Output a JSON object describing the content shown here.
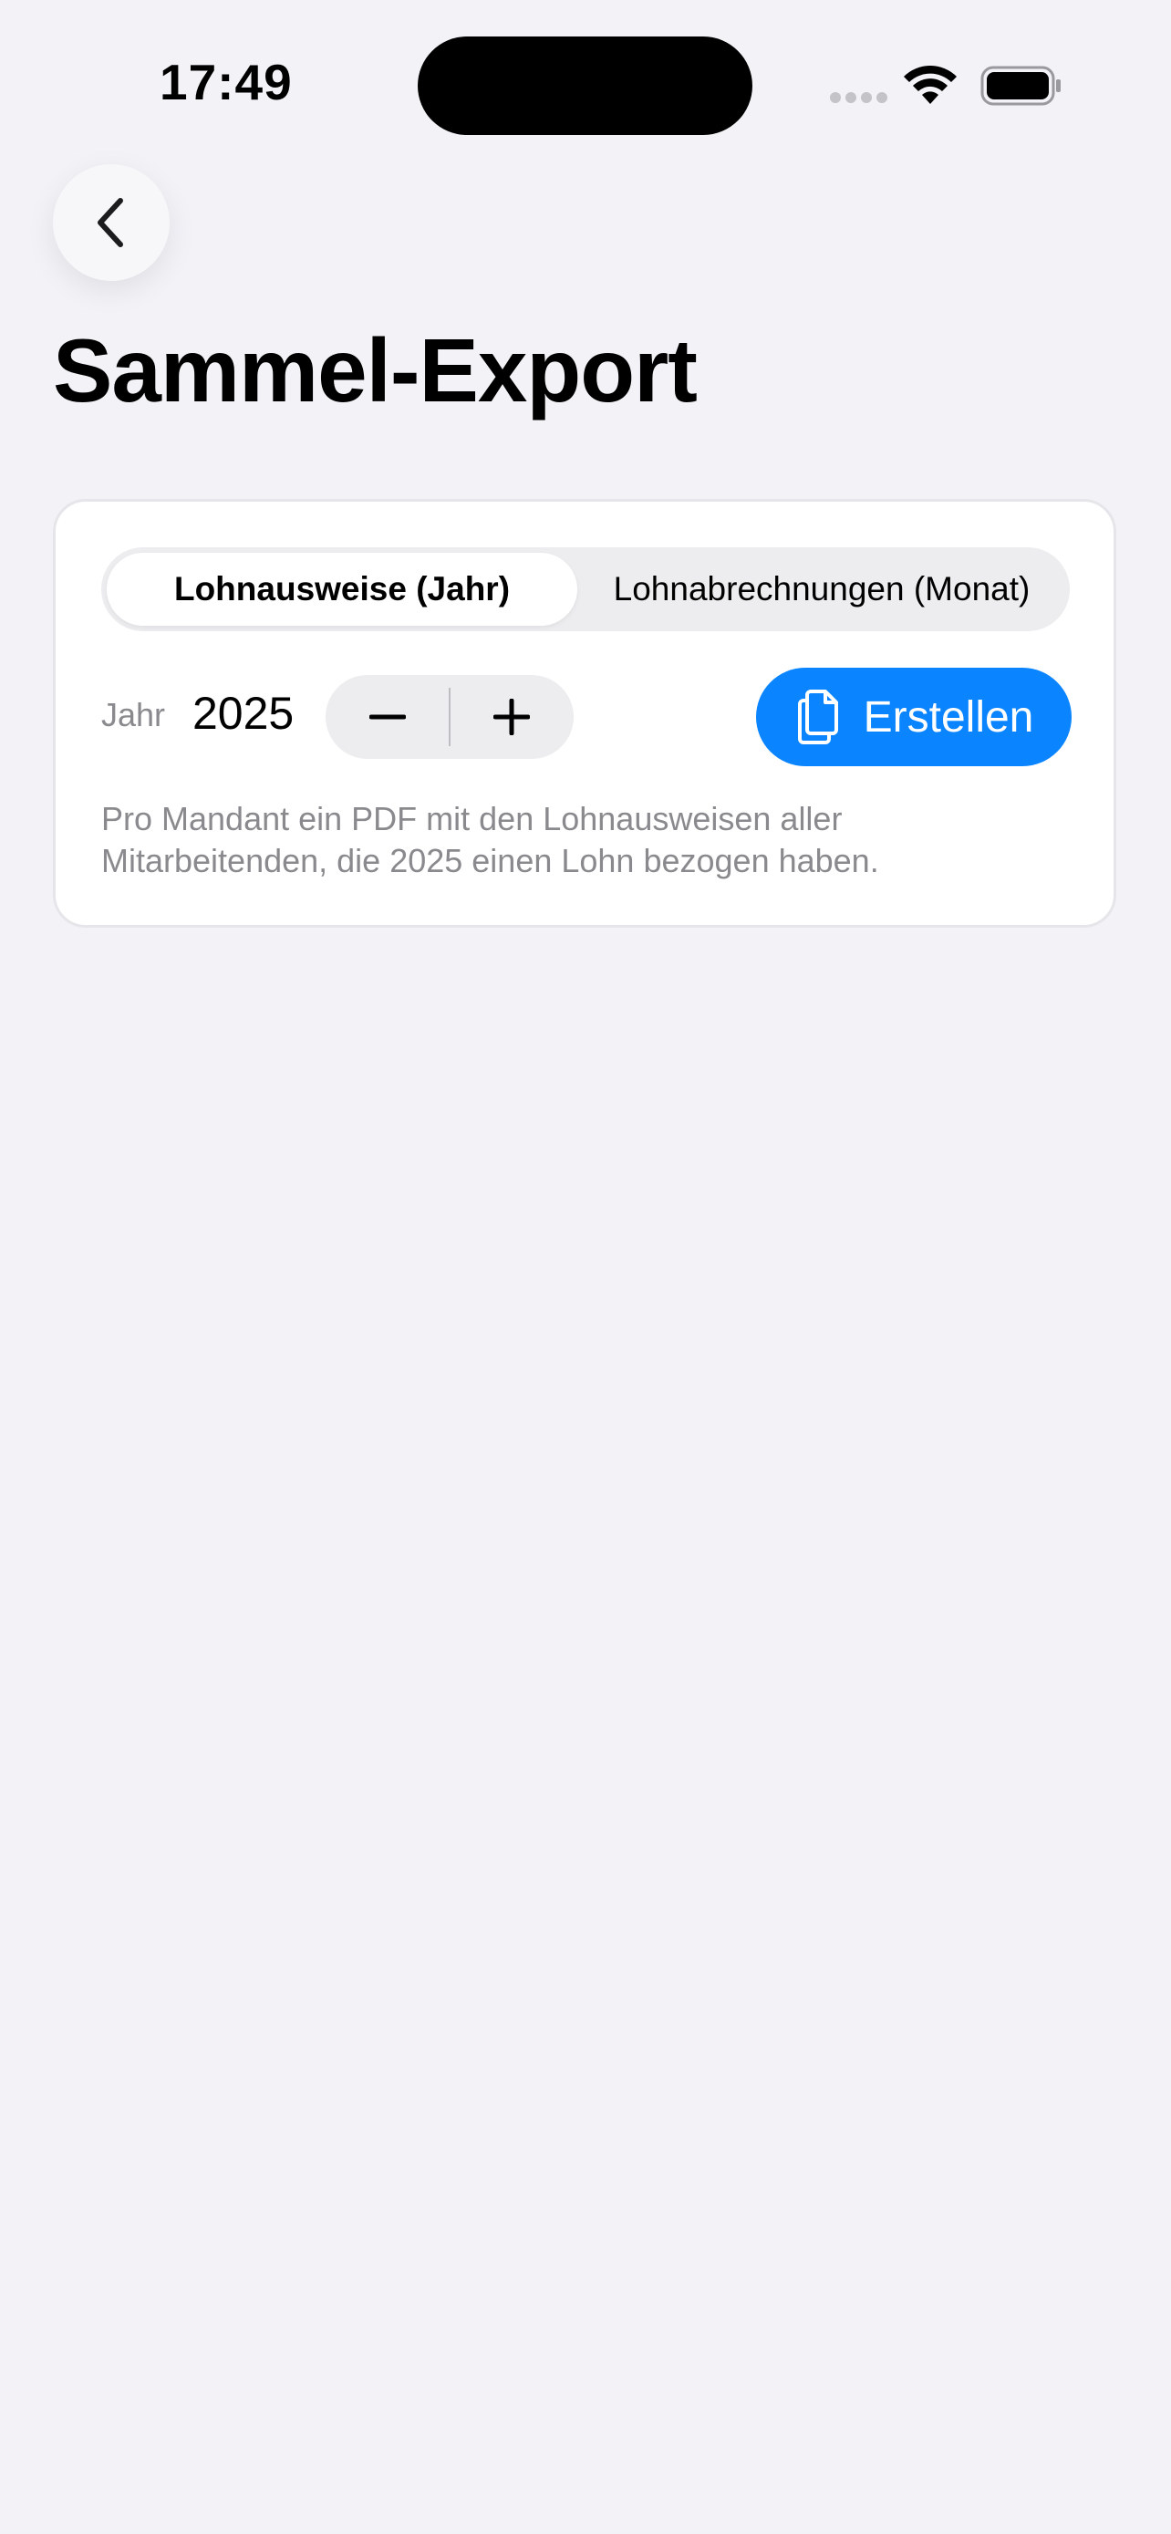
{
  "status_bar": {
    "time": "17:49"
  },
  "header": {
    "back_icon": "chevron-left-icon",
    "title": "Sammel-Export"
  },
  "segmented_control": {
    "options": [
      "Lohnausweise (Jahr)",
      "Lohnabrechnungen (Monat)"
    ],
    "selected": "Lohnausweise (Jahr)"
  },
  "year": {
    "label": "Jahr",
    "value": "2025",
    "decrement_icon": "minus-icon",
    "increment_icon": "plus-icon"
  },
  "create_button": {
    "label": "Erstellen",
    "icon": "documents-icon"
  },
  "hint": "Pro Mandant ein PDF mit den Lohnausweisen aller Mitarbeitenden, die 2025 einen Lohn bezogen haben.",
  "colors": {
    "accent": "#0a84ff",
    "background": "#f2f2f7",
    "secondary_text": "#8a8a8e"
  }
}
